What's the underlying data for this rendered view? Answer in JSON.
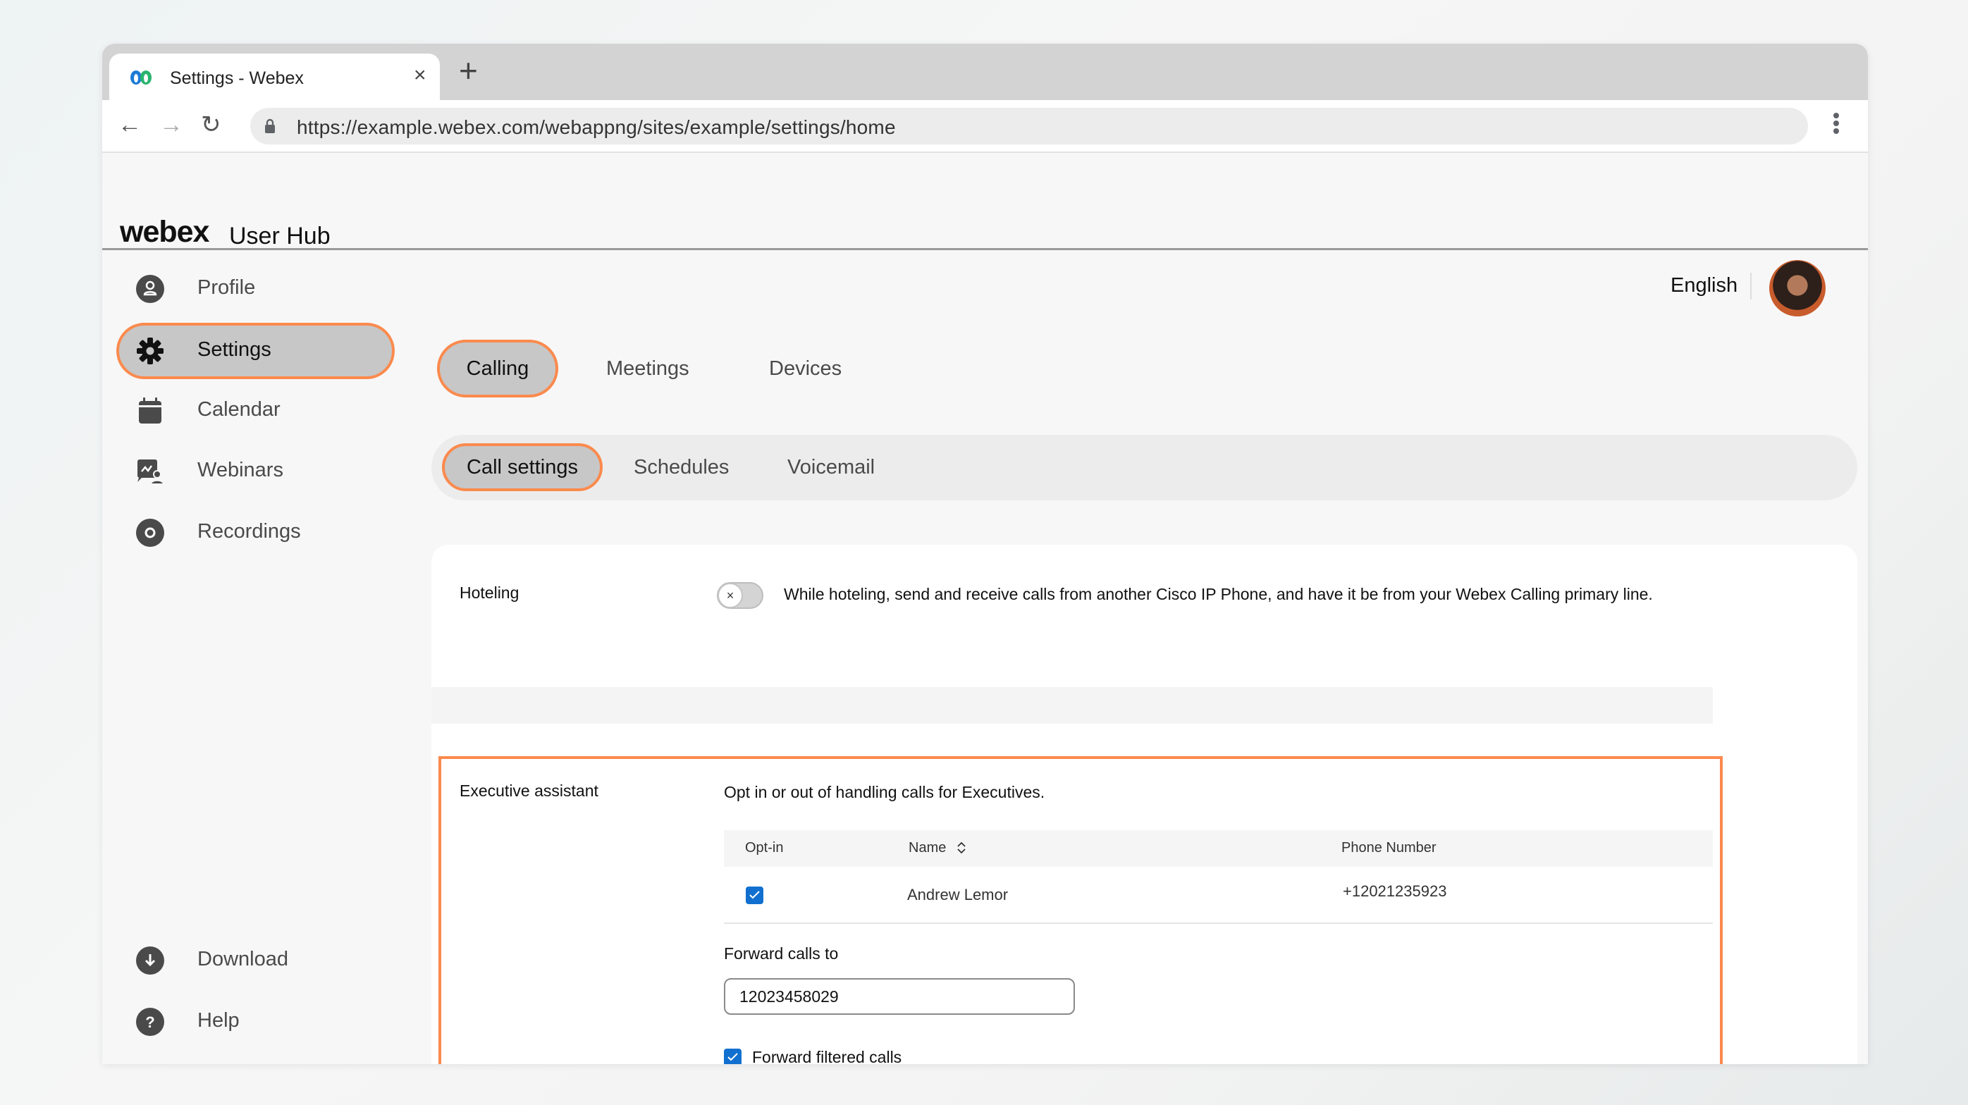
{
  "browser": {
    "tab_title": "Settings - Webex",
    "tab_close": "×",
    "new_tab": "+",
    "back": "←",
    "forward": "→",
    "reload": "↻",
    "url": "https://example.webex.com/webappng/sites/example/settings/home"
  },
  "app": {
    "brand": "webex",
    "product": "User Hub",
    "language": "English"
  },
  "sidebar": {
    "items": [
      {
        "label": "Profile",
        "icon": "profile-icon"
      },
      {
        "label": "Settings",
        "icon": "gear-icon",
        "active": true
      },
      {
        "label": "Calendar",
        "icon": "calendar-icon"
      },
      {
        "label": "Webinars",
        "icon": "webinar-icon"
      },
      {
        "label": "Recordings",
        "icon": "recording-icon"
      }
    ],
    "bottom": [
      {
        "label": "Download",
        "icon": "download-icon"
      },
      {
        "label": "Help",
        "icon": "help-icon"
      }
    ]
  },
  "tabs": [
    {
      "label": "Calling",
      "active": true
    },
    {
      "label": "Meetings"
    },
    {
      "label": "Devices"
    }
  ],
  "subtabs": [
    {
      "label": "Call settings",
      "active": true
    },
    {
      "label": "Schedules"
    },
    {
      "label": "Voicemail"
    }
  ],
  "hoteling": {
    "label": "Hoteling",
    "enabled": false,
    "toggle_glyph": "×",
    "description": "While hoteling, send and receive calls from another Cisco IP Phone, and have it be from your Webex Calling primary line."
  },
  "executive_assistant": {
    "label": "Executive assistant",
    "description": "Opt in or out of handling calls for Executives.",
    "columns": [
      "Opt-in",
      "Name",
      "Phone Number"
    ],
    "rows": [
      {
        "opt_in": true,
        "name": "Andrew Lemor",
        "phone": "+12021235923"
      }
    ],
    "forward_label": "Forward calls to",
    "forward_value": "12023458029",
    "forward_filtered_label": "Forward filtered calls",
    "forward_filtered_checked": true
  },
  "colors": {
    "highlight": "#fb8a4d",
    "checkbox": "#1170cf",
    "active_pill": "#c7c7c7"
  }
}
